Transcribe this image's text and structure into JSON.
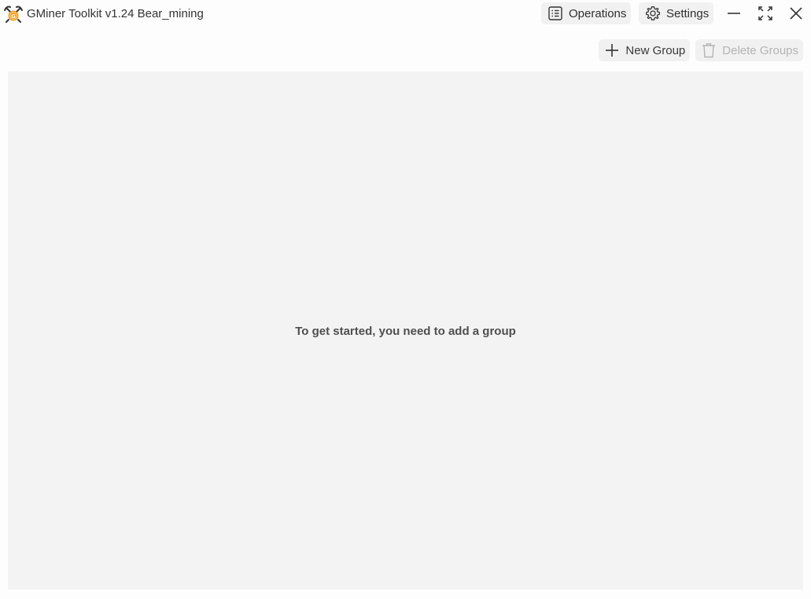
{
  "window": {
    "title": "GMiner Toolkit v1.24 Bear_mining",
    "logo_icon": "pickaxe-coin-logo-icon"
  },
  "titlebar": {
    "operations_label": "Operations",
    "operations_icon": "list-icon",
    "settings_label": "Settings",
    "settings_icon": "gear-icon",
    "minimize_icon": "minimize-icon",
    "maximize_icon": "maximize-icon",
    "close_icon": "close-icon"
  },
  "toolbar": {
    "new_group_label": "New Group",
    "new_group_icon": "plus-icon",
    "delete_groups_label": "Delete Groups",
    "delete_groups_icon": "trash-icon"
  },
  "main": {
    "empty_message": "To get started, you need to add a group"
  },
  "colors": {
    "window_bg": "#fdfdfd",
    "content_bg": "#f3f3f3",
    "button_bg": "#f1f1f1",
    "logo_orange": "#f29a1d",
    "disabled_text": "#b4b4b4"
  }
}
